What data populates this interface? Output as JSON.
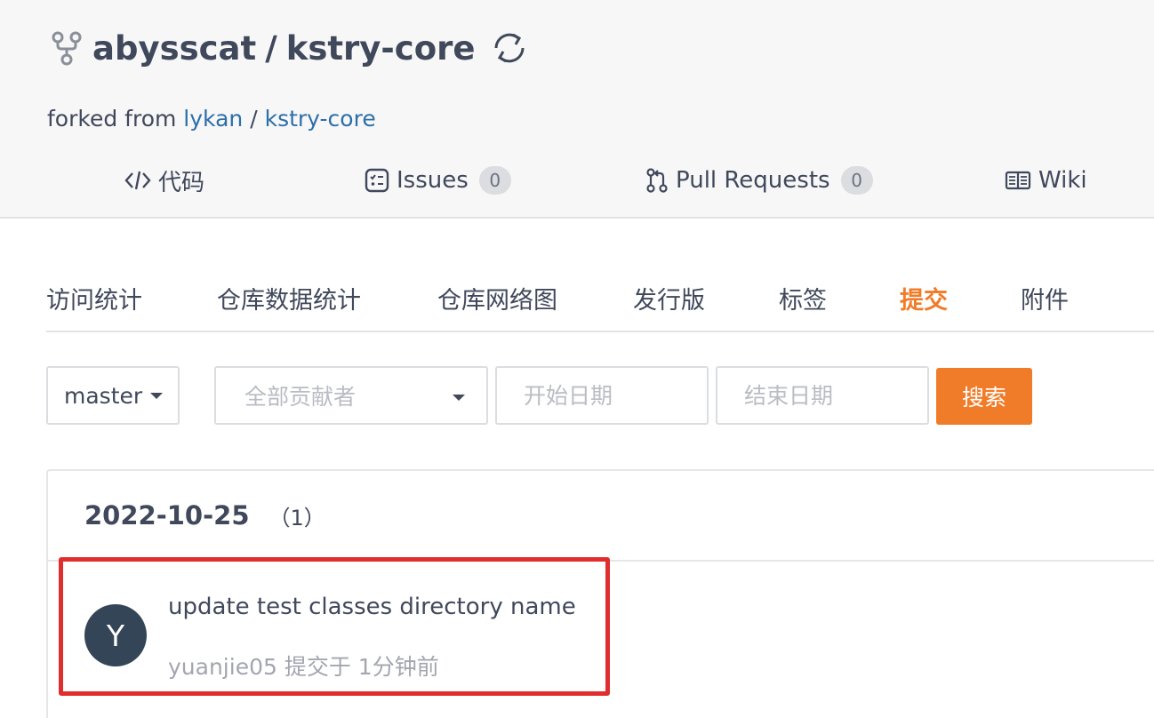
{
  "repo": {
    "owner": "abysscat",
    "separator": "/",
    "name": "kstry-core",
    "forked_prefix": "forked from",
    "forked_owner": "lykan",
    "forked_separator": "/",
    "forked_repo": "kstry-core"
  },
  "nav": {
    "code": "代码",
    "issues": "Issues",
    "issues_count": "0",
    "pulls": "Pull Requests",
    "pulls_count": "0",
    "wiki": "Wiki"
  },
  "subnav": {
    "items": [
      "访问统计",
      "仓库数据统计",
      "仓库网络图",
      "发行版",
      "标签",
      "提交",
      "附件"
    ],
    "active": "提交"
  },
  "filters": {
    "branch": "master",
    "contributors_placeholder": "全部贡献者",
    "start_date_placeholder": "开始日期",
    "end_date_placeholder": "结束日期",
    "search_label": "搜索"
  },
  "commits": {
    "date": "2022-10-25",
    "count": "（1）",
    "items": [
      {
        "avatar_letter": "Y",
        "message": "update test classes directory name",
        "meta": "yuanjie05 提交于 1分钟前"
      }
    ]
  },
  "colors": {
    "accent": "#f07c2a",
    "link": "#2d6fa8",
    "highlight": "#e02e2e",
    "avatar_bg": "#354558"
  },
  "icons": [
    "fork-icon",
    "sync-icon",
    "code-icon",
    "issues-icon",
    "pull-request-icon",
    "wiki-icon",
    "caret-down-icon"
  ]
}
